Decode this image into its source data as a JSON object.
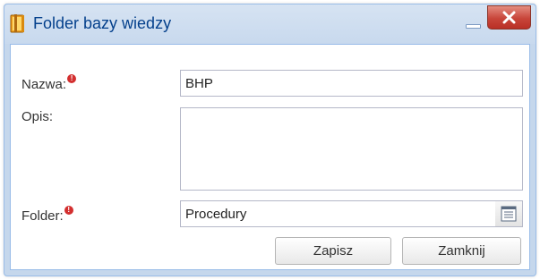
{
  "window": {
    "title": "Folder bazy wiedzy",
    "title_icon": "folder-book-icon",
    "minimize_icon": "minimize-icon",
    "close_icon": "close-icon"
  },
  "form": {
    "name_label": "Nazwa:",
    "name_value": "BHP",
    "description_label": "Opis:",
    "description_value": "",
    "folder_label": "Folder:",
    "folder_value": "Procedury",
    "required_icon": "required-icon",
    "picker_icon": "list-picker-icon"
  },
  "buttons": {
    "save_label": "Zapisz",
    "close_label": "Zamknij"
  },
  "colors": {
    "title_text": "#04408c",
    "window_frame": "#c5d7ec",
    "close_button": "#c8453a",
    "required_marker": "#d32f2f"
  }
}
